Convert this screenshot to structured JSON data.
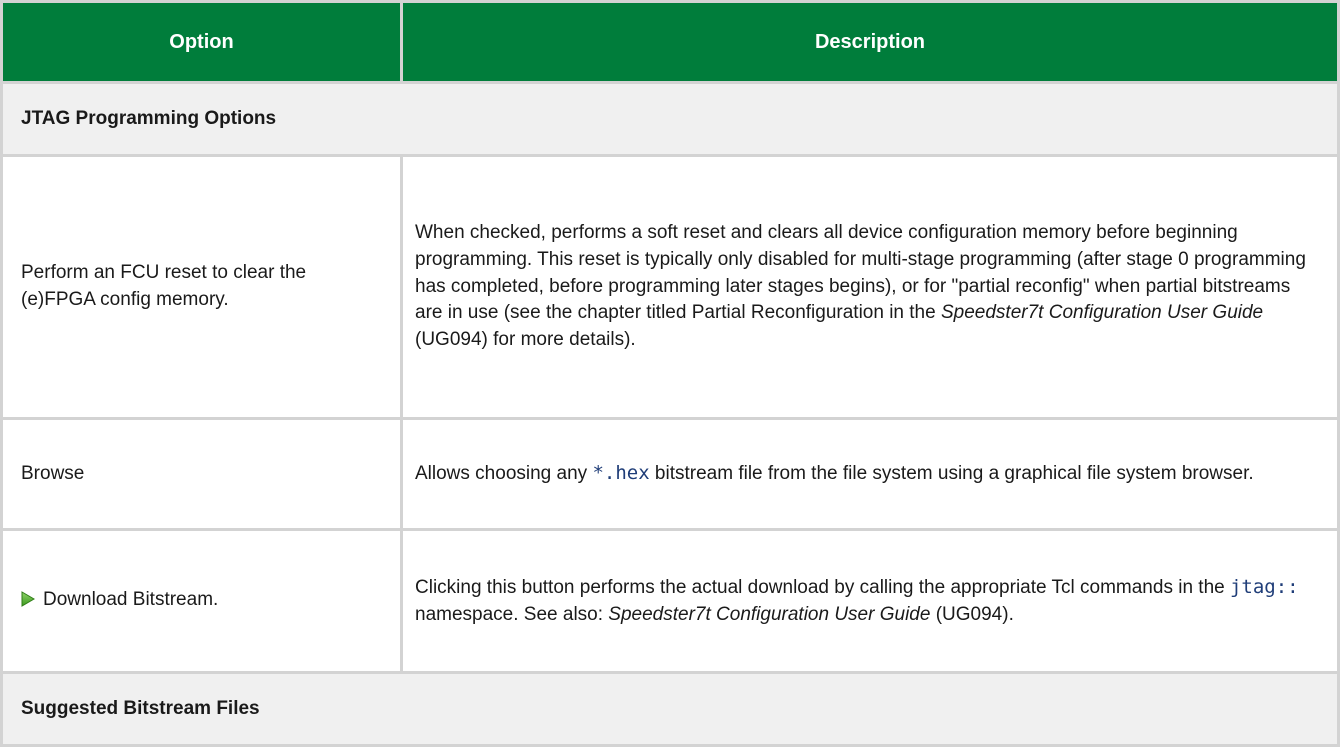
{
  "header": {
    "option": "Option",
    "description": "Description"
  },
  "sections": {
    "jtag": "JTAG Programming Options",
    "suggested": "Suggested Bitstream Files"
  },
  "rows": [
    {
      "option": "Perform an FCU reset to clear the (e)FPGA config memory.",
      "desc_part1": "When checked, performs a soft reset and clears all device configuration memory before beginning programming. This reset is typically only disabled for multi-stage programming (after stage 0 programming has completed, before programming later stages begins), or for \"partial reconfig\" when partial bitstreams are in use (see the chapter titled Partial Reconfiguration in the ",
      "desc_italic": "Speedster7t Configuration User Guide",
      "desc_part2": " (UG094) for more details)."
    },
    {
      "option": "Browse",
      "desc_part1": "Allows choosing any ",
      "desc_code": "*.hex",
      "desc_part2": " bitstream file from the file system using a graphical file system browser."
    },
    {
      "option": "Download Bitstream.",
      "icon": "play-icon",
      "icon_color": "#4caf2a",
      "desc_part1": "Clicking this button performs the actual download by calling the appropriate Tcl commands in the ",
      "desc_code": "jtag::",
      "desc_part2": " namespace. See also: ",
      "desc_italic": "Speedster7t Configuration User Guide",
      "desc_part3": " (UG094)."
    }
  ]
}
